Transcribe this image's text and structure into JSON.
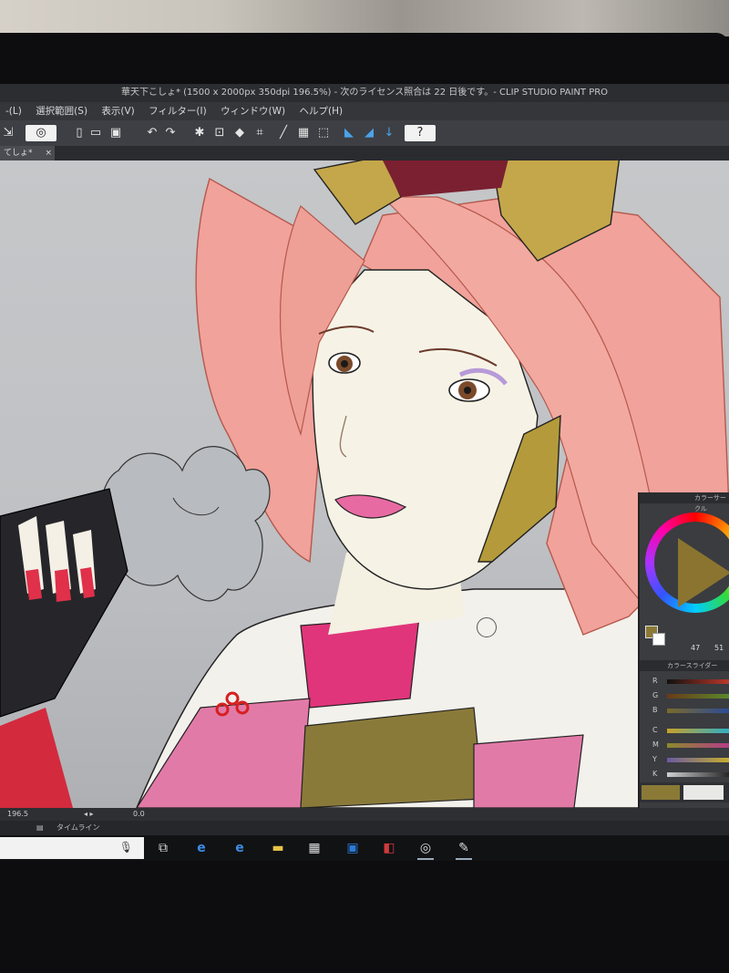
{
  "window": {
    "title": "華天下こしょ* (1500 x 2000px 350dpi 196.5%) - 次のライセンス照合は 22 日後です。- CLIP STUDIO PAINT PRO"
  },
  "menu": [
    "-(L)",
    "選択範囲(S)",
    "表示(V)",
    "フィルター(I)",
    "ウィンドウ(W)",
    "ヘルプ(H)"
  ],
  "tab": {
    "label": "てしょ*",
    "close": "×"
  },
  "color_panel": {
    "title": "カラーサークル",
    "value_a": "47",
    "value_b": "51",
    "slider_title": "カラースライダー",
    "rgb": [
      "R",
      "G",
      "B"
    ],
    "cmyk": [
      "C",
      "M",
      "Y",
      "K"
    ],
    "colors": {
      "r": "#c0392b",
      "g": "#5a8a2a",
      "b": "#2a4a9a",
      "c": "#2ab0c8",
      "m": "#b83a8a",
      "y": "#c8b02a",
      "k": "#222222"
    }
  },
  "statusbar": {
    "zoom": "196.5",
    "extra": "0.0"
  },
  "timeline": {
    "label": "タイムライン"
  },
  "taskbar": {
    "icons": [
      "task-view-icon",
      "ie-icon",
      "edge-icon",
      "explorer-icon",
      "store-icon",
      "outlook-icon",
      "app-icon",
      "clip-studio-icon",
      "clip-studio-paint-icon"
    ]
  }
}
